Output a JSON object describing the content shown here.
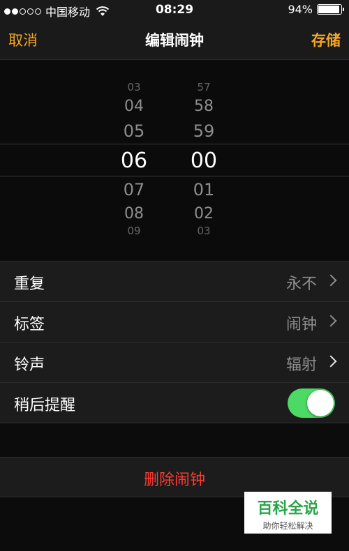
{
  "status_bar": {
    "carrier": "中国移动",
    "time": "08:29",
    "battery_percent": "94%",
    "battery_level": 0.94,
    "signal_dots_filled": 2,
    "signal_dots_total": 5
  },
  "nav": {
    "cancel_label": "取消",
    "title": "编辑闹钟",
    "save_label": "存储"
  },
  "picker": {
    "hours": {
      "above": [
        "03",
        "04",
        "05"
      ],
      "selected": "06",
      "below": [
        "07",
        "08",
        "09"
      ]
    },
    "minutes": {
      "above": [
        "57",
        "58",
        "59"
      ],
      "selected": "00",
      "below": [
        "01",
        "02",
        "03"
      ]
    }
  },
  "settings": {
    "repeat": {
      "label": "重复",
      "value": "永不"
    },
    "label": {
      "label": "标签",
      "value": "闹钟"
    },
    "sound": {
      "label": "铃声",
      "value": "辐射"
    },
    "snooze": {
      "label": "稍后提醒",
      "on": true
    }
  },
  "delete_label": "删除闹钟",
  "watermark": {
    "title": "百科全说",
    "subtitle": "助你轻松解决"
  },
  "colors": {
    "accent": "#f5a623",
    "toggle_on": "#4cd964",
    "destructive": "#ff3b30"
  }
}
